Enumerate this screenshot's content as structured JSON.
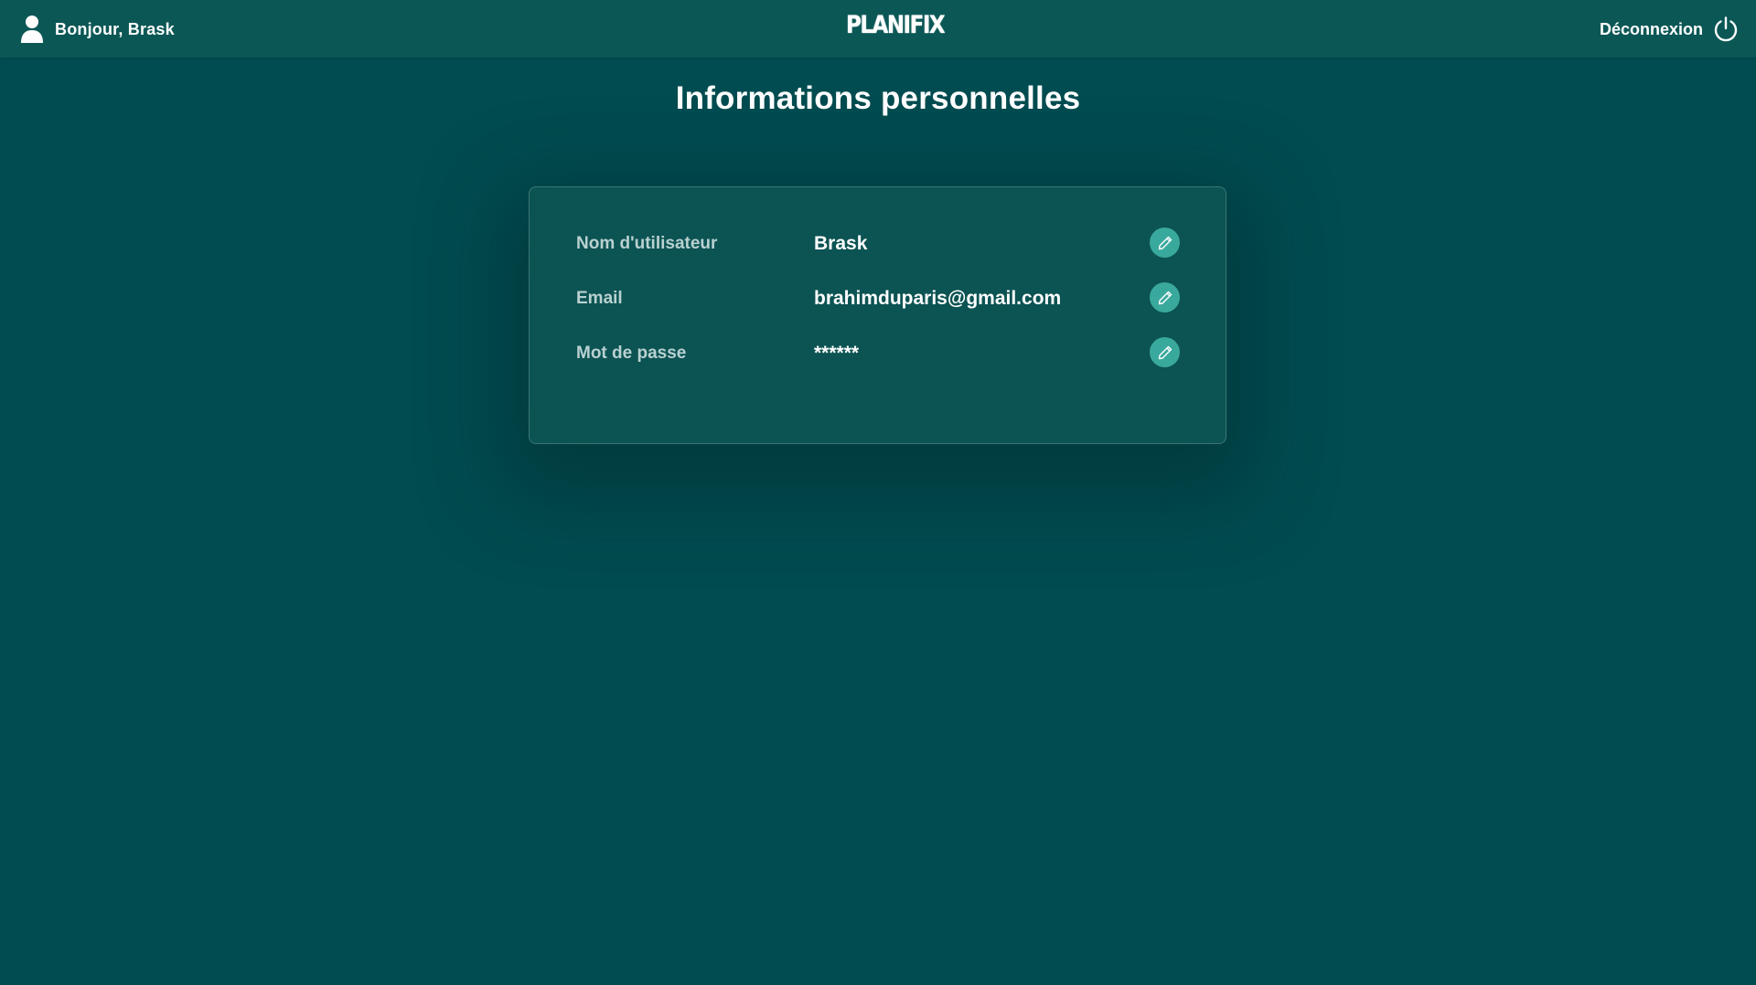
{
  "header": {
    "greeting": "Bonjour, Brask",
    "logo_text": "PLANIFIX",
    "logout_label": "Déconnexion"
  },
  "page": {
    "title": "Informations personnelles"
  },
  "profile": {
    "fields": [
      {
        "label": "Nom d'utilisateur",
        "value": "Brask"
      },
      {
        "label": "Email",
        "value": "brahimduparis@gmail.com"
      },
      {
        "label": "Mot de passe",
        "value": "******"
      }
    ]
  },
  "icons": {
    "user": "user-icon",
    "logout": "power-icon",
    "edit": "pencil-icon"
  },
  "colors": {
    "background": "#004c50",
    "header": "#0b5756",
    "card": "#0c5353",
    "accent": "#3aa99d",
    "label": "#b9d1d1"
  }
}
